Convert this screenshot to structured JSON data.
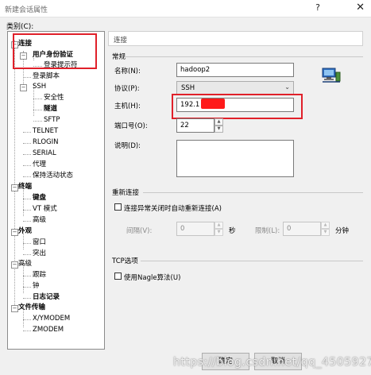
{
  "window": {
    "title": "新建会话属性",
    "help": "?",
    "close": "✕"
  },
  "category_label": "类别(C):",
  "tree": [
    {
      "label": "连接",
      "bold": true,
      "toggle": "−"
    },
    {
      "label": "用户身份验证",
      "bold": true,
      "toggle": "−"
    },
    {
      "label": "登录提示符",
      "bold": false
    },
    {
      "label": "登录脚本",
      "bold": false
    },
    {
      "label": "SSH",
      "bold": false,
      "toggle": "−"
    },
    {
      "label": "安全性",
      "bold": false
    },
    {
      "label": "隧道",
      "bold": true
    },
    {
      "label": "SFTP",
      "bold": false
    },
    {
      "label": "TELNET",
      "bold": false
    },
    {
      "label": "RLOGIN",
      "bold": false
    },
    {
      "label": "SERIAL",
      "bold": false
    },
    {
      "label": "代理",
      "bold": false
    },
    {
      "label": "保持活动状态",
      "bold": false
    },
    {
      "label": "终端",
      "bold": true,
      "toggle": "−"
    },
    {
      "label": "键盘",
      "bold": true
    },
    {
      "label": "VT 模式",
      "bold": false
    },
    {
      "label": "高级",
      "bold": false
    },
    {
      "label": "外观",
      "bold": true,
      "toggle": "−"
    },
    {
      "label": "窗口",
      "bold": false
    },
    {
      "label": "突出",
      "bold": false
    },
    {
      "label": "高级",
      "bold": false,
      "toggle": "−"
    },
    {
      "label": "跟踪",
      "bold": false
    },
    {
      "label": "钟",
      "bold": false
    },
    {
      "label": "日志记录",
      "bold": true
    },
    {
      "label": "文件传输",
      "bold": true,
      "toggle": "−"
    },
    {
      "label": "X/YMODEM",
      "bold": false
    },
    {
      "label": "ZMODEM",
      "bold": false
    }
  ],
  "header": "连接",
  "general": {
    "title": "常规",
    "name_label": "名称(N):",
    "name_value": "hadoop2",
    "protocol_label": "协议(P):",
    "protocol_value": "SSH",
    "host_label": "主机(H):",
    "host_value": "192.1",
    "port_label": "端口号(O):",
    "port_value": "22",
    "desc_label": "说明(D):"
  },
  "reconnect": {
    "title": "重新连接",
    "checkbox_label": "连接异常关闭时自动重新连接(A)",
    "interval_label": "间隔(V):",
    "interval_value": "0",
    "interval_unit": "秒",
    "limit_label": "限制(L):",
    "limit_value": "0",
    "limit_unit": "分钟"
  },
  "tcp": {
    "title": "TCP选项",
    "nagle_label": "使用Nagle算法(U)"
  },
  "buttons": {
    "ok": "确定",
    "cancel": "取消"
  },
  "watermark": "https://blog.csdn.net/qq_45059279",
  "colors": {
    "highlight_box": "#e0202a",
    "redaction": "#ff1a1a"
  }
}
